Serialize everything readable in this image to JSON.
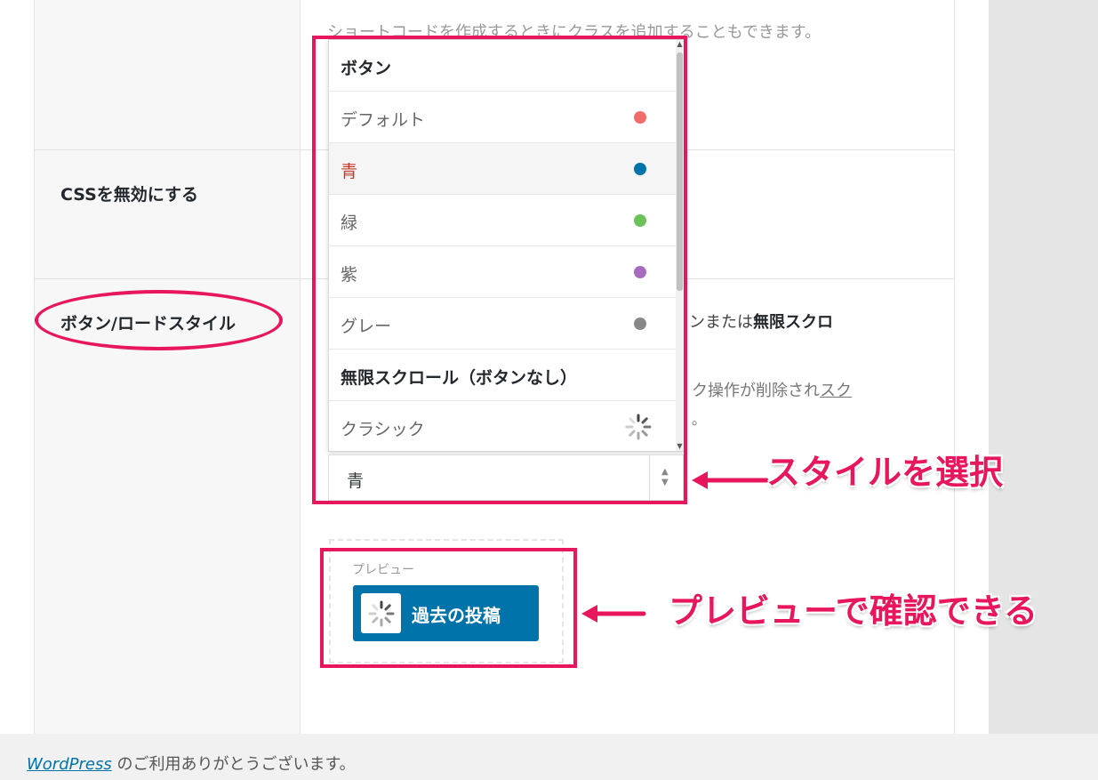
{
  "top_hint": "ショートコードを作成するときにクラスを追加することもできます。",
  "settings": {
    "disable_css_label": "CSSを無効にする",
    "button_style_label": "ボタン/ロードスタイル"
  },
  "description": {
    "line1_prefix": "ンまたは",
    "line1_bold": "無限スクロ",
    "line2_prefix": "ク操作が削除され",
    "line2_underline": "スク",
    "line3": "。"
  },
  "dropdown": {
    "items": [
      {
        "label": "ボタン",
        "type": "group"
      },
      {
        "label": "デフォルト",
        "type": "option",
        "color": "#f06c6c"
      },
      {
        "label": "青",
        "type": "option",
        "color": "#0073aa",
        "selected": true
      },
      {
        "label": "緑",
        "type": "option",
        "color": "#6ac259"
      },
      {
        "label": "紫",
        "type": "option",
        "color": "#a86cbf"
      },
      {
        "label": "グレー",
        "type": "option",
        "color": "#888888"
      },
      {
        "label": "無限スクロール（ボタンなし）",
        "type": "group"
      },
      {
        "label": "クラシック",
        "type": "option",
        "icon": "spinner-icon"
      }
    ]
  },
  "select": {
    "value": "青"
  },
  "preview": {
    "label": "プレビュー",
    "button_label": "過去の投稿"
  },
  "footer": {
    "link_text": "WordPress",
    "text": " のご利用ありがとうございます。"
  },
  "annotations": {
    "select_style": "スタイルを選択",
    "preview_check": "プレビューで確認できる"
  },
  "colors": {
    "accent": "#e8175d",
    "wp_blue": "#0073aa"
  }
}
